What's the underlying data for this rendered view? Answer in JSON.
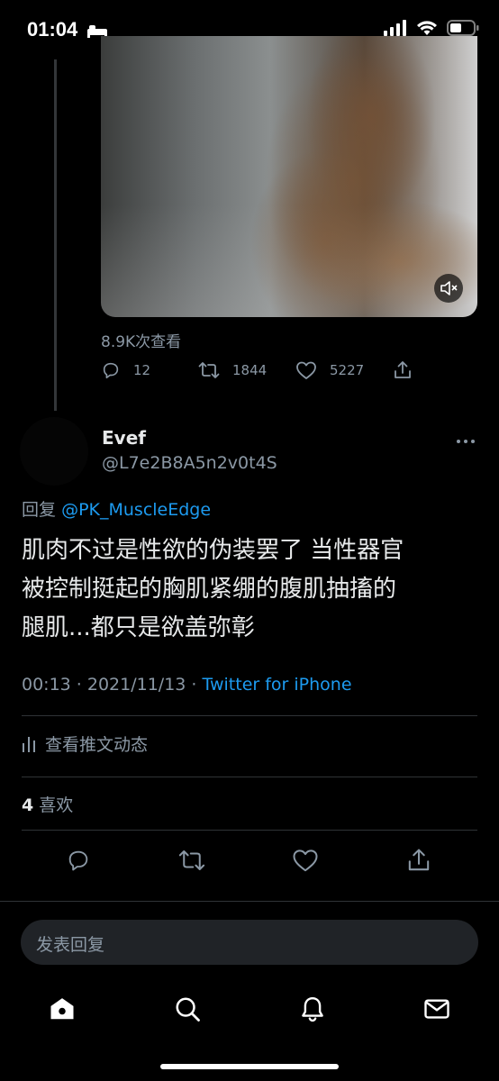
{
  "status_bar": {
    "time": "01:04"
  },
  "parent_tweet": {
    "views": "8.9K次查看",
    "replies": "12",
    "retweets": "1844",
    "likes": "5227"
  },
  "reply_tweet": {
    "display_name": "Evef",
    "handle": "@L7e2B8A5n2v0t4S",
    "reply_label": "回复",
    "reply_to": "@PK_MuscleEdge",
    "text_lines": [
      "肌肉不过是性欲的伪装罢了 当性器官",
      "被控制挺起的胸肌紧绷的腹肌抽搐的",
      "腿肌...都只是欲盖弥彰"
    ],
    "timestamp": "00:13 · 2021/11/13 · ",
    "source": "Twitter for iPhone",
    "activity_label": "查看推文动态",
    "likes_count": "4",
    "likes_label": "喜欢"
  },
  "composer": {
    "placeholder": "发表回复"
  },
  "colors": {
    "accent": "#1d9bf0",
    "muted": "#8b98a5",
    "text": "#e7e9ea",
    "background": "#000000"
  }
}
